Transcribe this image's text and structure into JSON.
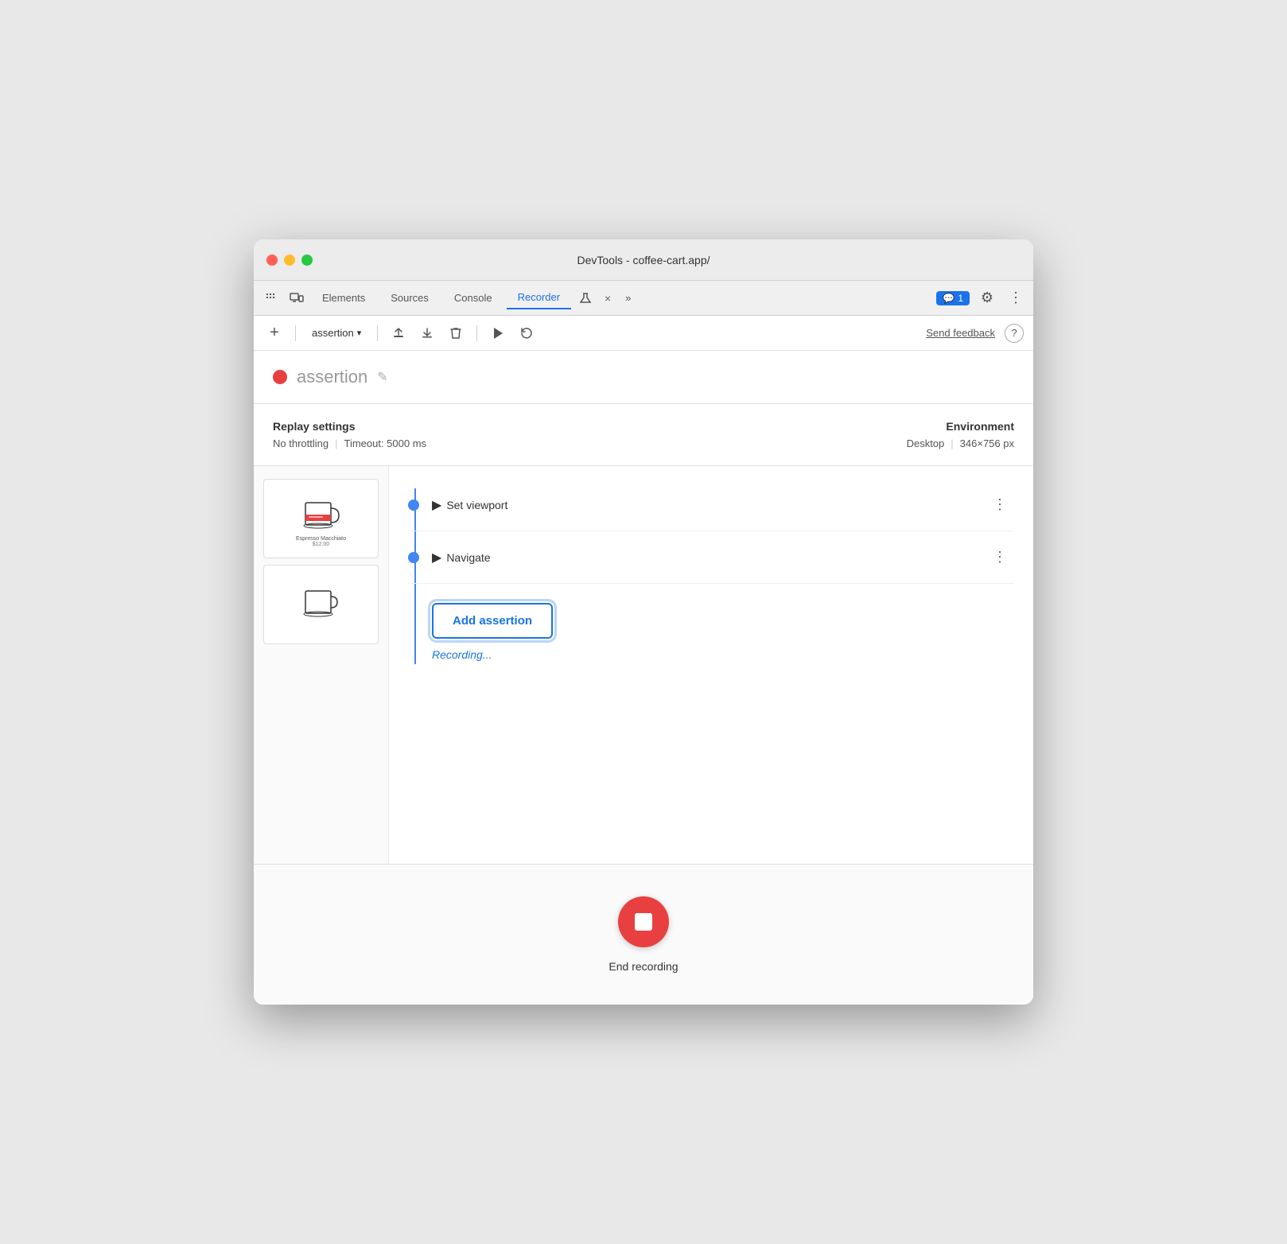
{
  "window": {
    "title": "DevTools - coffee-cart.app/"
  },
  "tabs": {
    "items": [
      {
        "label": "Elements",
        "active": false
      },
      {
        "label": "Sources",
        "active": false
      },
      {
        "label": "Console",
        "active": false
      },
      {
        "label": "Recorder",
        "active": true
      }
    ],
    "close_icon": "×",
    "more_icon": "»",
    "badge": {
      "count": "1",
      "icon": "💬"
    },
    "gear_icon": "⚙",
    "dots_icon": "⋮"
  },
  "toolbar": {
    "add_icon": "+",
    "recording_name": "assertion",
    "dropdown_arrow": "▾",
    "export_icon": "↑",
    "download_icon": "↓",
    "delete_icon": "🗑",
    "play_icon": "▶",
    "replay_icon": "↺",
    "send_feedback": "Send feedback",
    "help_icon": "?"
  },
  "recording": {
    "dot_color": "#e84040",
    "title": "assertion",
    "edit_icon": "✎"
  },
  "replay_settings": {
    "section_title": "Replay settings",
    "throttle": "No throttling",
    "timeout": "Timeout: 5000 ms"
  },
  "environment": {
    "section_title": "Environment",
    "device": "Desktop",
    "resolution": "346×756 px"
  },
  "steps": [
    {
      "label": "Set viewport",
      "has_dot": true
    },
    {
      "label": "Navigate",
      "has_dot": true
    }
  ],
  "add_assertion": {
    "button_label": "Add assertion"
  },
  "recording_status": {
    "text": "Recording..."
  },
  "end_recording": {
    "button_label": "End recording"
  }
}
